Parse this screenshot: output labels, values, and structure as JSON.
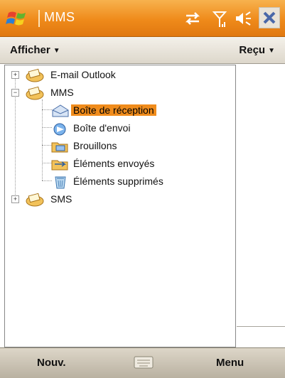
{
  "titlebar": {
    "title": "MMS",
    "close_label": "✕",
    "accent": "#ef8a1a"
  },
  "headbar": {
    "view_label": "Afficher",
    "sort_label": "Reçu"
  },
  "tree": {
    "items": [
      {
        "label": "E-mail Outlook",
        "expander": "+",
        "icon": "mail-folder-icon"
      },
      {
        "label": "MMS",
        "expander": "−",
        "icon": "mail-folder-icon"
      },
      {
        "label": "Boîte de réception",
        "icon": "inbox-icon",
        "selected": true
      },
      {
        "label": "Boîte d'envoi",
        "icon": "outbox-icon"
      },
      {
        "label": "Brouillons",
        "icon": "drafts-folder-icon"
      },
      {
        "label": "Éléments envoyés",
        "icon": "sent-folder-icon"
      },
      {
        "label": "Éléments supprimés",
        "icon": "deleted-items-icon"
      },
      {
        "label": "SMS",
        "expander": "+",
        "icon": "mail-folder-icon"
      }
    ]
  },
  "softkeys": {
    "left": "Nouv.",
    "right": "Menu"
  }
}
